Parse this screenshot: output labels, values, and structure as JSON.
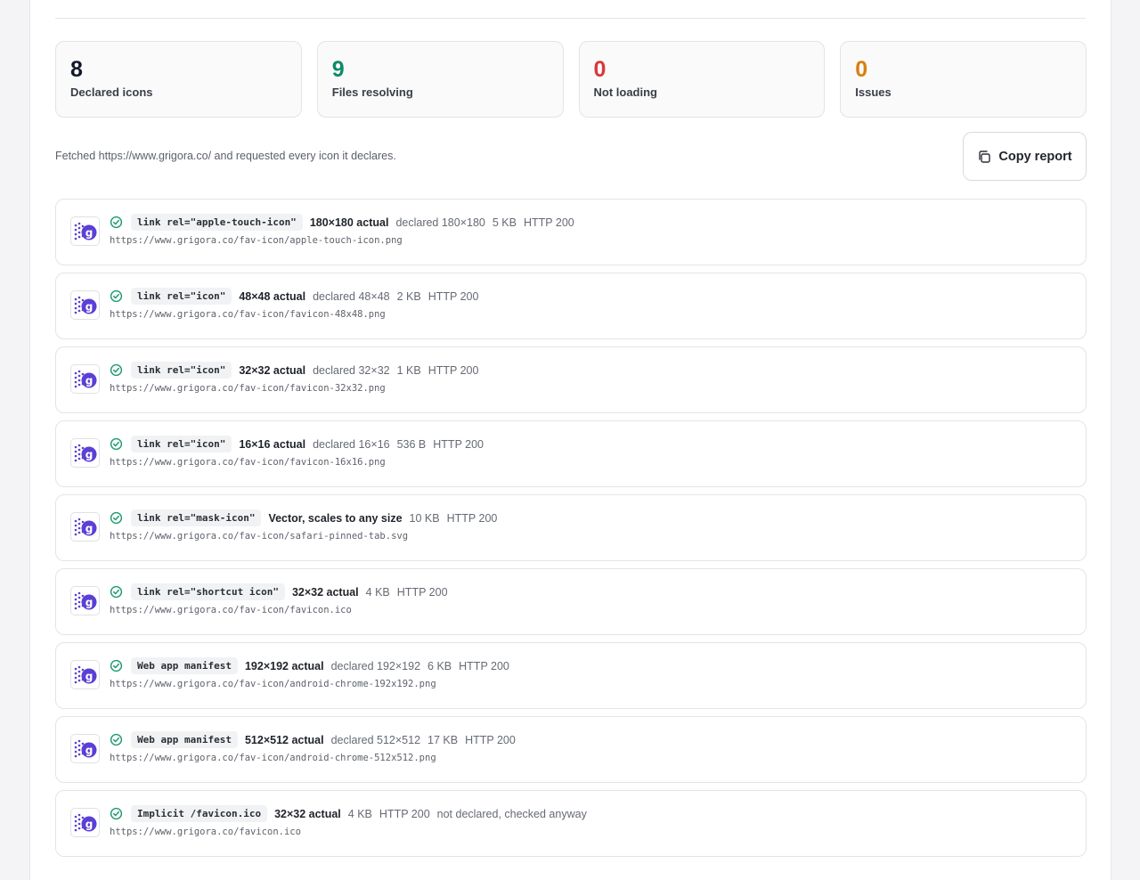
{
  "colors": {
    "declared": "#111827",
    "resolving": "#0e8a66",
    "not_loading": "#d93838",
    "issues": "#d97f0e",
    "check": "#1e9a6e",
    "icon_purple": "#5b3fd6"
  },
  "stats": [
    {
      "value": "8",
      "label": "Declared icons",
      "color": "#111827"
    },
    {
      "value": "9",
      "label": "Files resolving",
      "color": "#0e8a66"
    },
    {
      "value": "0",
      "label": "Not loading",
      "color": "#d93838"
    },
    {
      "value": "0",
      "label": "Issues",
      "color": "#d97f0e"
    }
  ],
  "info_text": "Fetched https://www.grigora.co/ and requested every icon it declares.",
  "copy_button": {
    "label": "Copy report",
    "icon": "copy-icon"
  },
  "icons": [
    {
      "tag": "link rel=\"apple-touch-icon\"",
      "actual": "180×180 actual",
      "meta": [
        "declared 180×180",
        "5 KB",
        "HTTP 200"
      ],
      "url": "https://www.grigora.co/fav-icon/apple-touch-icon.png",
      "status_icon": "check-circle-icon"
    },
    {
      "tag": "link rel=\"icon\"",
      "actual": "48×48 actual",
      "meta": [
        "declared 48×48",
        "2 KB",
        "HTTP 200"
      ],
      "url": "https://www.grigora.co/fav-icon/favicon-48x48.png",
      "status_icon": "check-circle-icon"
    },
    {
      "tag": "link rel=\"icon\"",
      "actual": "32×32 actual",
      "meta": [
        "declared 32×32",
        "1 KB",
        "HTTP 200"
      ],
      "url": "https://www.grigora.co/fav-icon/favicon-32x32.png",
      "status_icon": "check-circle-icon"
    },
    {
      "tag": "link rel=\"icon\"",
      "actual": "16×16 actual",
      "meta": [
        "declared 16×16",
        "536 B",
        "HTTP 200"
      ],
      "url": "https://www.grigora.co/fav-icon/favicon-16x16.png",
      "status_icon": "check-circle-icon"
    },
    {
      "tag": "link rel=\"mask-icon\"",
      "actual": "Vector, scales to any size",
      "meta": [
        "10 KB",
        "HTTP 200"
      ],
      "url": "https://www.grigora.co/fav-icon/safari-pinned-tab.svg",
      "status_icon": "check-circle-icon"
    },
    {
      "tag": "link rel=\"shortcut icon\"",
      "actual": "32×32 actual",
      "meta": [
        "4 KB",
        "HTTP 200"
      ],
      "url": "https://www.grigora.co/fav-icon/favicon.ico",
      "status_icon": "check-circle-icon"
    },
    {
      "tag": "Web app manifest",
      "actual": "192×192 actual",
      "meta": [
        "declared 192×192",
        "6 KB",
        "HTTP 200"
      ],
      "url": "https://www.grigora.co/fav-icon/android-chrome-192x192.png",
      "status_icon": "check-circle-icon"
    },
    {
      "tag": "Web app manifest",
      "actual": "512×512 actual",
      "meta": [
        "declared 512×512",
        "17 KB",
        "HTTP 200"
      ],
      "url": "https://www.grigora.co/fav-icon/android-chrome-512x512.png",
      "status_icon": "check-circle-icon"
    },
    {
      "tag": "Implicit /favicon.ico",
      "actual": "32×32 actual",
      "meta": [
        "4 KB",
        "HTTP 200",
        "not declared, checked anyway"
      ],
      "url": "https://www.grigora.co/favicon.ico",
      "status_icon": "check-circle-icon"
    }
  ]
}
